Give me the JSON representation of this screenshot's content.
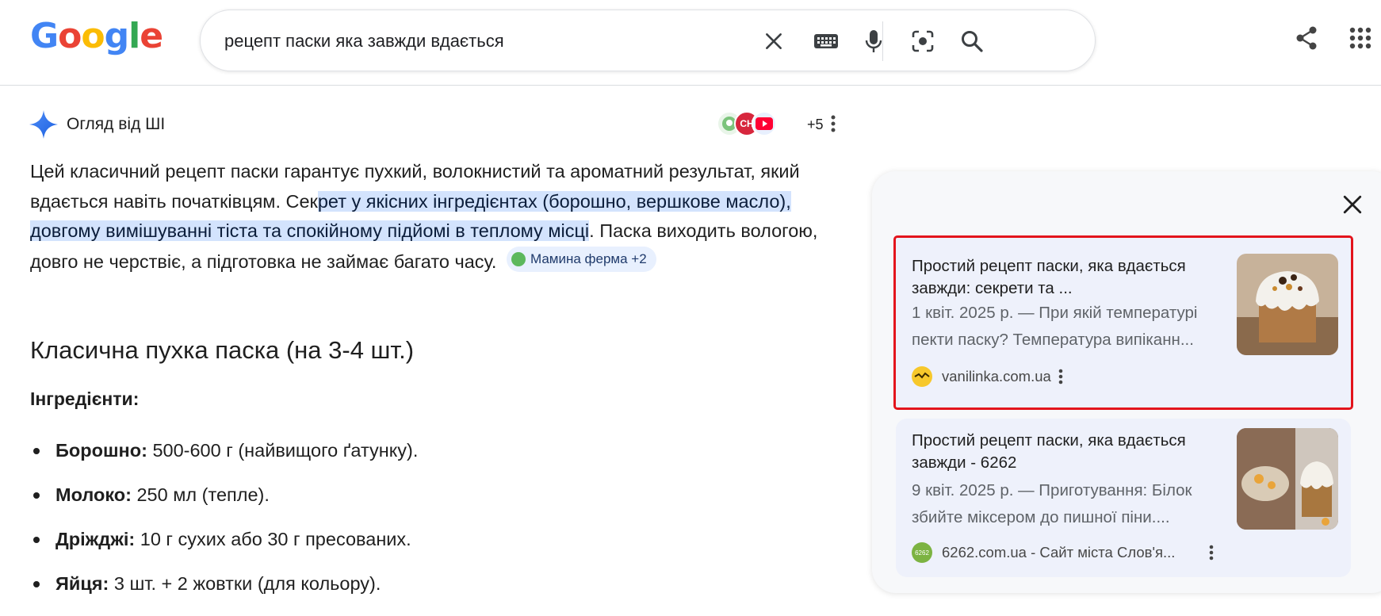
{
  "header": {
    "logo_letters": [
      "G",
      "o",
      "o",
      "g",
      "l",
      "e"
    ],
    "search_query": "рецепт паски яка завжди вдається",
    "icons": [
      "clear-icon",
      "keyboard-icon",
      "microphone-icon",
      "lens-icon",
      "search-icon",
      "share-icon",
      "apps-icon"
    ]
  },
  "ai_overview": {
    "title": "Огляд від ШІ",
    "source_count": "+5",
    "paragraph": {
      "before": "Цей класичний рецепт паски гарантує пухкий, волокнистий та ароматний результат, який вдається навіть початківцям. Сек",
      "highlight": "рет у якісних інгредієнтах (борошно, вершкове масло), довгому вимішуванні тіста та спокійному підйомі в теплому місці",
      "after": ". Паска виходить вологою, довго не черствіє, а підготовка не займає багато часу.",
      "chip": "Мамина ферма +2"
    },
    "section_title": "Класична пухка паска (на 3-4 шт.)",
    "ingredients_label": "Інгредієнти:",
    "ingredients": [
      {
        "name": "Борошно:",
        "text": " 500-600 г (найвищого ґатунку)."
      },
      {
        "name": "Молоко:",
        "text": " 250 мл (тепле)."
      },
      {
        "name": "Дріжджі:",
        "text": " 10 г сухих або 30 г пресованих."
      },
      {
        "name": "Яйця:",
        "text": " 3 шт. + 2 жовтки (для кольору)."
      }
    ]
  },
  "side_panel": {
    "cards": [
      {
        "title": "Простий рецепт паски, яка вдається завжди: секрети та ...",
        "snippet": "1 квіт. 2025 р. — При якій температурі пекти паску? Температура випіканн...",
        "site": "vanilinka.com.ua"
      },
      {
        "title": "Простий рецепт паски, яка вдається завжди - 6262",
        "snippet": "9 квіт. 2025 р. — Приготування: Білок збийте міксером до пишної піни....",
        "site": "6262.com.ua - Сайт міста Слов'я..."
      }
    ]
  },
  "colors": {
    "highlight_bg": "#d3e3fd",
    "selection_outline": "#e3141c",
    "card_bg": "#eef1fb"
  }
}
